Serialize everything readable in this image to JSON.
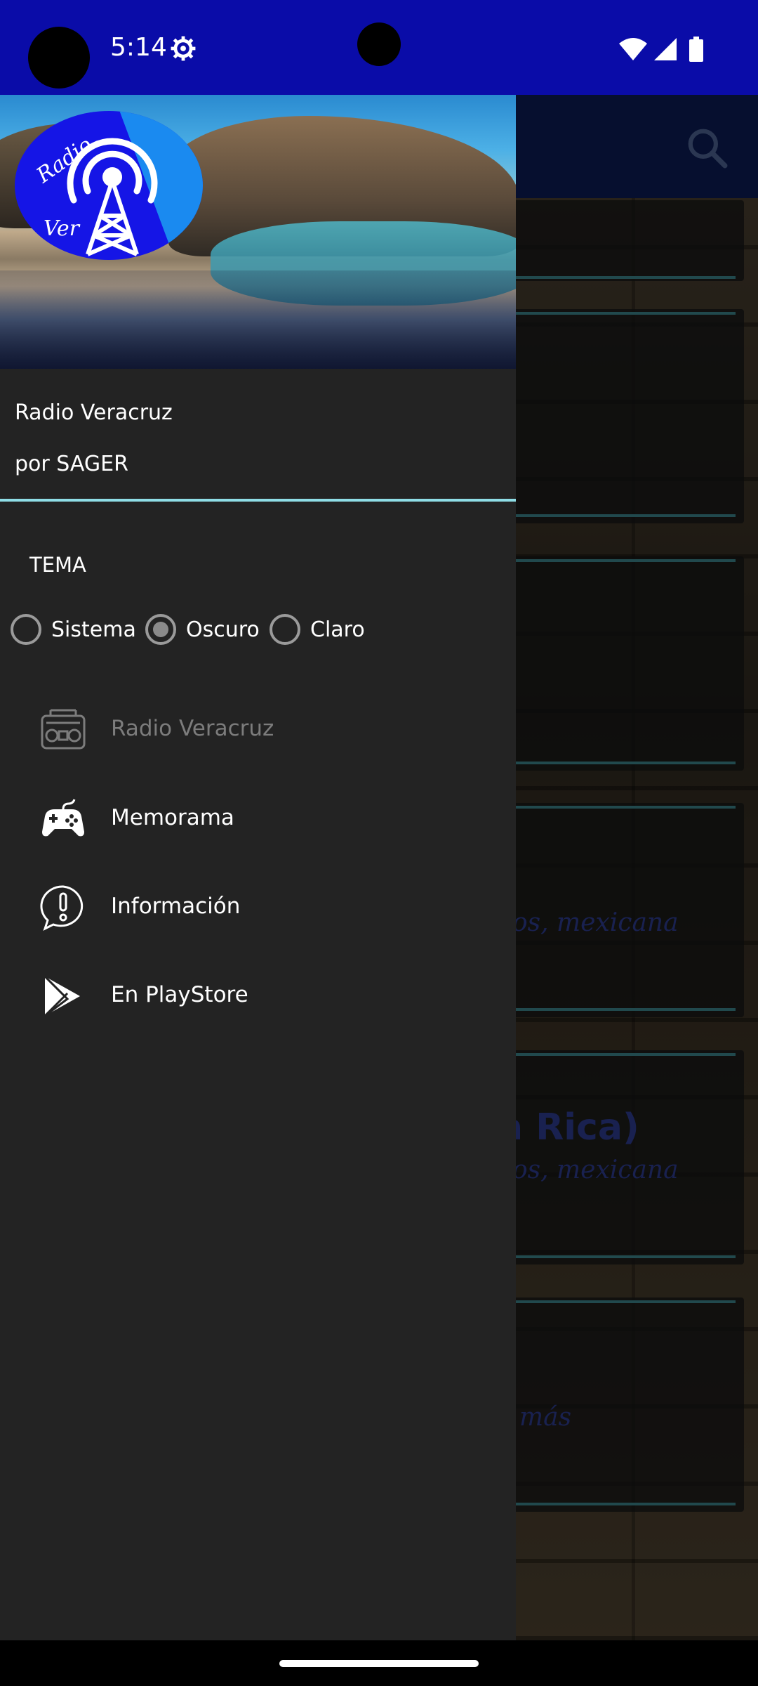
{
  "status_bar": {
    "time": "5:14"
  },
  "background": {
    "card_texts": [
      "os, mexicana",
      "os, mexicana",
      "más"
    ],
    "card_title": "a Rica)"
  },
  "drawer": {
    "app_name": "Radio Veracruz",
    "app_subtitle": "por SAGER",
    "logo_text": {
      "top": "Radio",
      "bottom": "Ver"
    },
    "theme": {
      "label": "TEMA",
      "options": [
        {
          "label": "Sistema",
          "selected": false
        },
        {
          "label": "Oscuro",
          "selected": true
        },
        {
          "label": "Claro",
          "selected": false
        }
      ]
    },
    "menu": [
      {
        "label": "Radio Veracruz",
        "icon": "radio-icon",
        "enabled": false
      },
      {
        "label": "Memorama",
        "icon": "gamepad-icon",
        "enabled": true
      },
      {
        "label": "Información",
        "icon": "info-bubble-icon",
        "enabled": true
      },
      {
        "label": "En PlayStore",
        "icon": "playstore-icon",
        "enabled": true
      }
    ]
  },
  "colors": {
    "status_bar": "#0a0ca8",
    "drawer_bg": "#232323",
    "accent_line": "#8fdde6",
    "bg_toolbar": "#0b1a52"
  }
}
